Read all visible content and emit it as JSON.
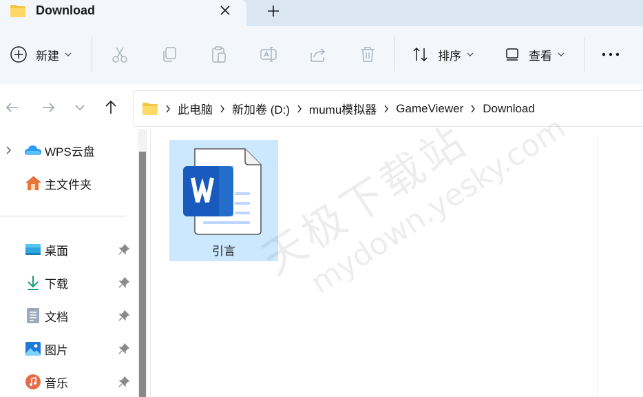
{
  "tab": {
    "title": "Download",
    "close_icon": "close-icon",
    "new_tab_icon": "plus-icon"
  },
  "toolbar": {
    "new_label": "新建",
    "sort_label": "排序",
    "view_label": "查看"
  },
  "breadcrumb": [
    {
      "label": "此电脑"
    },
    {
      "label": "新加卷 (D:)"
    },
    {
      "label": "mumu模拟器"
    },
    {
      "label": "GameViewer"
    },
    {
      "label": "Download"
    }
  ],
  "sidebar": {
    "cloud": {
      "label": "WPS云盘"
    },
    "home": {
      "label": "主文件夹"
    },
    "pinned": [
      {
        "label": "桌面"
      },
      {
        "label": "下载"
      },
      {
        "label": "文档"
      },
      {
        "label": "图片"
      },
      {
        "label": "音乐"
      }
    ]
  },
  "files": [
    {
      "name": "引言",
      "type": "word-document"
    }
  ],
  "watermark": {
    "line1": "天极下载站",
    "line2": "mydown.yesky.com"
  },
  "colors": {
    "accent": "#0067c0",
    "selection": "#cce8ff",
    "word_blue": "#185abd",
    "folder": "#f4c542"
  }
}
